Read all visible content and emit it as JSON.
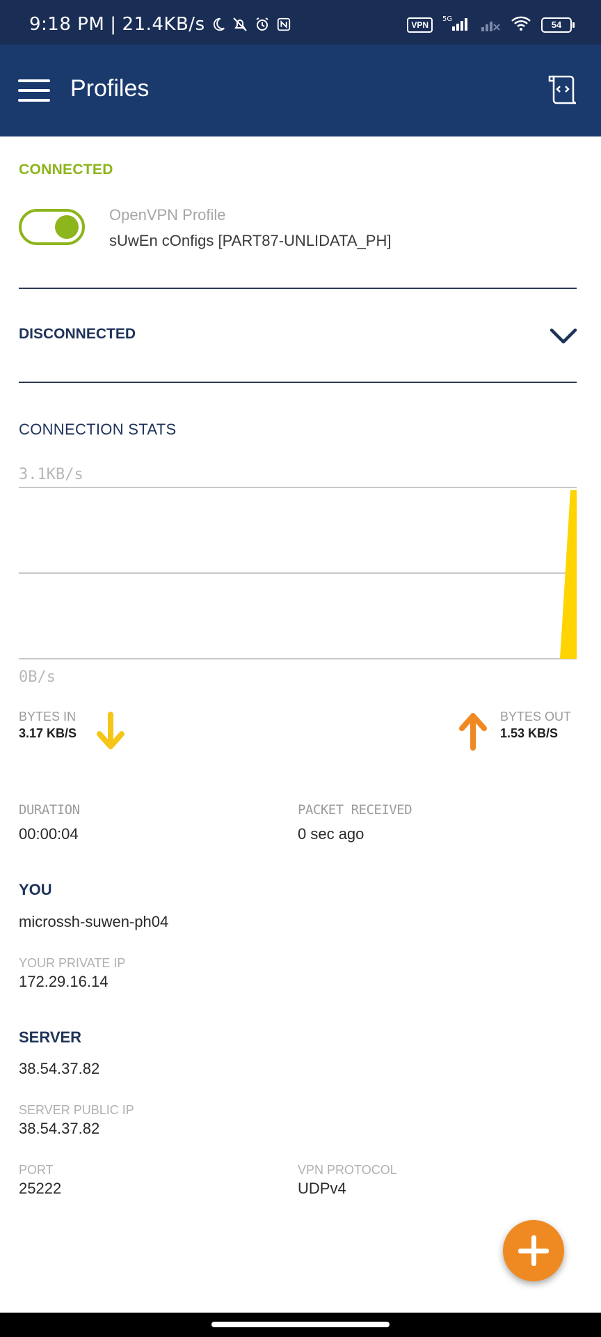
{
  "status_bar": {
    "time": "9:18 PM",
    "speed": "21.4KB/s",
    "vpn_badge": "VPN",
    "battery": "54",
    "network": "5G"
  },
  "app_bar": {
    "title": "Profiles"
  },
  "connected": {
    "label": "CONNECTED",
    "profile_type": "OpenVPN Profile",
    "profile_name": "sUwEn cOnfigs [PART87-UNLIDATA_PH]",
    "toggle_on": true
  },
  "disconnected": {
    "label": "DISCONNECTED"
  },
  "stats": {
    "label": "CONNECTION STATS",
    "chart_data": {
      "type": "area",
      "y_max_label": "3.1KB/s",
      "y_min_label": "0B/s",
      "ylim": [
        0,
        3.1
      ],
      "grid": true
    },
    "bytes_in": {
      "label": "BYTES IN",
      "value": "3.17 KB/S",
      "color": "#f5c518"
    },
    "bytes_out": {
      "label": "BYTES OUT",
      "value": "1.53 KB/S",
      "color": "#ef8a22"
    }
  },
  "duration": {
    "label": "DURATION",
    "value": "00:00:04"
  },
  "packet_received": {
    "label": "PACKET RECEIVED",
    "value": "0 sec ago"
  },
  "you": {
    "heading": "YOU",
    "name": "microssh-suwen-ph04",
    "private_ip_label": "YOUR PRIVATE IP",
    "private_ip": "172.29.16.14"
  },
  "server": {
    "heading": "SERVER",
    "address": "38.54.37.82",
    "public_ip_label": "SERVER PUBLIC IP",
    "public_ip": "38.54.37.82",
    "port_label": "PORT",
    "port": "25222",
    "protocol_label": "VPN PROTOCOL",
    "protocol": "UDPv4"
  },
  "colors": {
    "app_bar": "#1a3a6e",
    "status_bar": "#1a2d55",
    "connected_green": "#8db51c",
    "navy_text": "#1e3358",
    "fab_orange": "#ef8a22",
    "chart_yellow": "#ffd400"
  }
}
